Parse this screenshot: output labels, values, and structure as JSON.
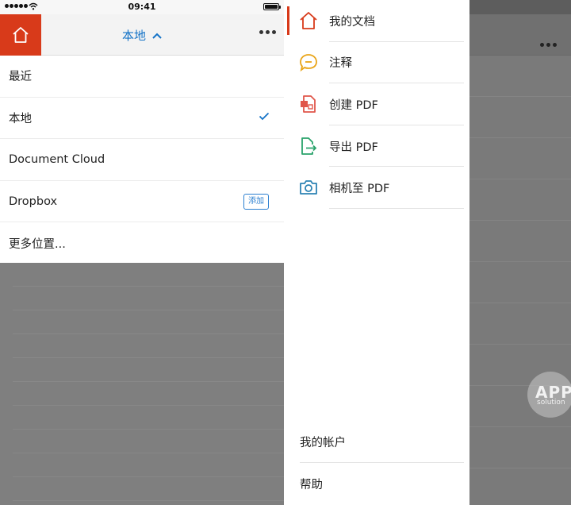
{
  "status_bar": {
    "time": "09:41"
  },
  "nav": {
    "title": "本地",
    "home_icon": "house-icon",
    "more_icon": "ellipsis-icon"
  },
  "location_menu": {
    "items": [
      {
        "label": "最近"
      },
      {
        "label": "本地",
        "selected": true
      },
      {
        "label": "Document Cloud"
      },
      {
        "label": "Dropbox",
        "badge": "添加"
      },
      {
        "label": "更多位置..."
      }
    ]
  },
  "drawer": {
    "items": [
      {
        "label": "我的文档",
        "icon": "house-icon",
        "color": "#d83a1a",
        "active": true
      },
      {
        "label": "注释",
        "icon": "comment-icon",
        "color": "#e9a417"
      },
      {
        "label": "创建 PDF",
        "icon": "create-pdf-icon",
        "color": "#e0564a"
      },
      {
        "label": "导出 PDF",
        "icon": "export-pdf-icon",
        "color": "#2aa36b"
      },
      {
        "label": "相机至 PDF",
        "icon": "camera-icon",
        "color": "#2d83b4"
      }
    ],
    "bottom": [
      {
        "label": "我的帐户"
      },
      {
        "label": "帮助"
      }
    ]
  },
  "watermark": {
    "line1": "APP",
    "line2": "solution"
  },
  "colors": {
    "accent": "#d83a1a",
    "link": "#1473c7"
  }
}
